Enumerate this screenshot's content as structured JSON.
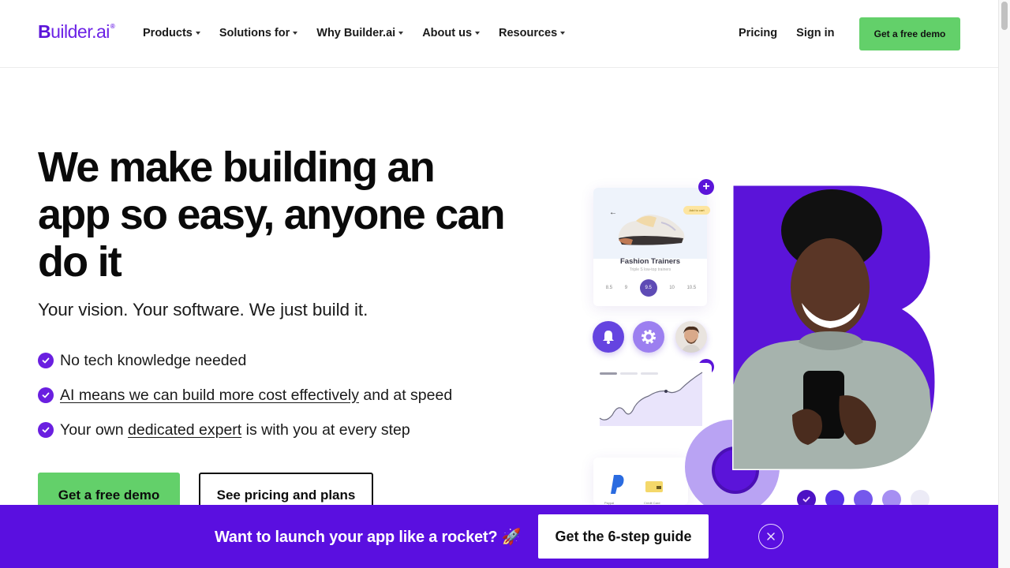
{
  "header": {
    "logo_initial": "B",
    "logo_rest": "uilder.ai",
    "logo_mark": "®",
    "nav": [
      {
        "label": "Products"
      },
      {
        "label": "Solutions for"
      },
      {
        "label": "Why Builder.ai"
      },
      {
        "label": "About us"
      },
      {
        "label": "Resources"
      }
    ],
    "pricing_label": "Pricing",
    "signin_label": "Sign in",
    "cta_label": "Get a free demo"
  },
  "hero": {
    "title": "We make building an app so easy, anyone can do it",
    "subtitle": "Your vision. Your software. We just build it.",
    "features": [
      {
        "link": "",
        "text": "No tech knowledge needed",
        "after": ""
      },
      {
        "link": "AI means we can build more cost effectively",
        "text": "",
        "after": " and at speed"
      },
      {
        "before": "Your own ",
        "link": "dedicated expert",
        "after": " is with you at every step"
      }
    ],
    "primary_cta": "Get a free demo",
    "secondary_cta": "See pricing and plans"
  },
  "illustration": {
    "product_title": "Fashion Trainers",
    "product_subtitle": "Triple S low-top trainers",
    "tag_label": "Add to cart",
    "sizes": [
      "8.5",
      "9",
      "9.5",
      "10",
      "10.5"
    ],
    "selected_size": "9.5",
    "payment_methods": [
      "Paypal",
      "Credit Card"
    ],
    "colors": {
      "brand_purple": "#5b14d9",
      "light_purple": "#9c7ff0"
    }
  },
  "banner": {
    "text": "Want to launch your app like a rocket? 🚀",
    "button_label": "Get the 6-step guide",
    "close_symbol": "×"
  },
  "colors": {
    "brand": "#5a0fe0",
    "cta_green": "#63d06a",
    "text": "#0d0d0d"
  }
}
